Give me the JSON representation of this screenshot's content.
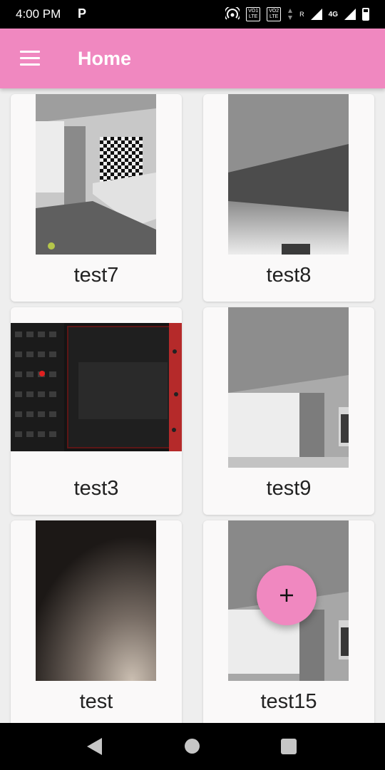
{
  "status_bar": {
    "time": "4:00 PM",
    "app_badge": "P",
    "vo1": "VO1",
    "lte1": "LTE",
    "vo2": "VO2",
    "lte2": "LTE",
    "roaming": "R",
    "network": "4G"
  },
  "header": {
    "title": "Home"
  },
  "grid": {
    "items": [
      {
        "label": "test7"
      },
      {
        "label": "test8"
      },
      {
        "label": "test3"
      },
      {
        "label": "test9"
      },
      {
        "label": "test"
      },
      {
        "label": "test15"
      }
    ]
  },
  "fab": {
    "symbol": "+"
  },
  "colors": {
    "primary": "#f088c0",
    "card": "#faf9f9",
    "background": "#eeeeee"
  },
  "icons": {
    "menu": "menu-icon",
    "fab": "plus-icon",
    "nav_back": "back-icon",
    "nav_home": "home-icon",
    "nav_recents": "recents-icon"
  }
}
